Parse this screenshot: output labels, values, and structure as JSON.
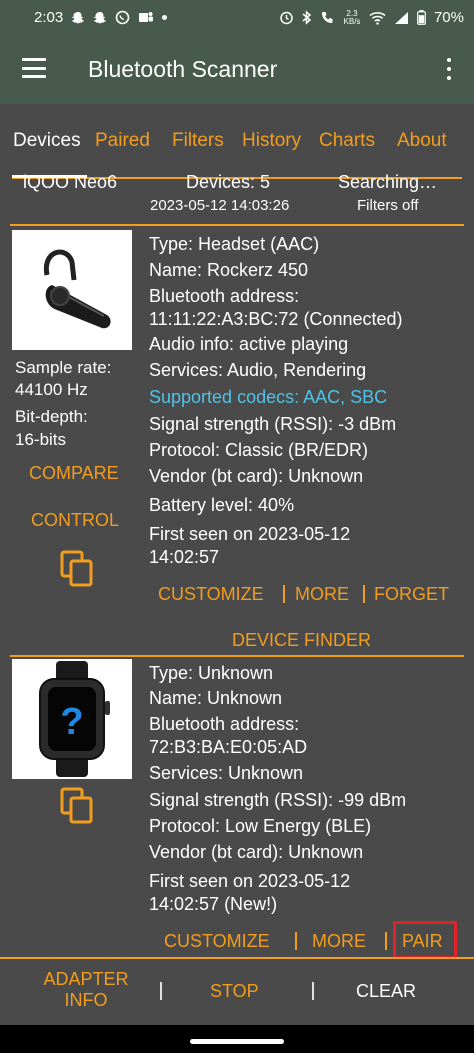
{
  "status_bar": {
    "time": "2:03",
    "battery": "70%",
    "network_speed": "2.3\nKB/s"
  },
  "app_bar": {
    "title": "Bluetooth Scanner"
  },
  "tabs": [
    {
      "label": "Devices"
    },
    {
      "label": "Paired"
    },
    {
      "label": "Filters"
    },
    {
      "label": "History"
    },
    {
      "label": "Charts"
    },
    {
      "label": "About"
    }
  ],
  "info": {
    "device_name": "iQOO Neo6",
    "devices_count": "Devices: 5",
    "status": "Searching…",
    "timestamp": "2023-05-12 14:03:26",
    "filters": "Filters off"
  },
  "devices": [
    {
      "type": "Type: Headset (AAC)",
      "name": "Name: Rockerz 450",
      "address_label": "Bluetooth address:",
      "address": "11:11:22:A3:BC:72 (Connected)",
      "audio_info": "Audio info: active playing",
      "services": "Services: Audio, Rendering",
      "codecs": "Supported codecs: AAC, SBC",
      "signal": "Signal strength (RSSI): -3 dBm",
      "protocol": "Protocol: Classic (BR/EDR)",
      "vendor": "Vendor (bt card): Unknown",
      "battery": "Battery level: 40%",
      "first_seen_label": "First seen on 2023-05-12",
      "first_seen_time": "14:02:57",
      "sample_rate_label": "Sample rate:",
      "sample_rate": "44100 Hz",
      "bit_depth_label": "Bit-depth:",
      "bit_depth": "16-bits",
      "compare_label": "COMPARE",
      "control_label": "CONTROL",
      "customize_label": "CUSTOMIZE",
      "more_label": "MORE",
      "forget_label": "FORGET",
      "finder_label": "DEVICE FINDER",
      "image_icon": "headset-image"
    },
    {
      "type": "Type: Unknown",
      "name": "Name: Unknown",
      "address_label": "Bluetooth address:",
      "address": "72:B3:BA:E0:05:AD",
      "services": "Services: Unknown",
      "signal": "Signal strength (RSSI): -99 dBm",
      "protocol": "Protocol: Low Energy (BLE)",
      "vendor": "Vendor (bt card): Unknown",
      "first_seen_label": "First seen on 2023-05-12",
      "first_seen_time": "14:02:57 (New!)",
      "customize_label": "CUSTOMIZE",
      "more_label": "MORE",
      "pair_label": "PAIR",
      "image_icon": "unknown-watch-image"
    }
  ],
  "bottom_bar": {
    "adapter_info_line1": "ADAPTER",
    "adapter_info_line2": "INFO",
    "stop_label": "STOP",
    "clear_label": "CLEAR"
  },
  "colors": {
    "accent": "#f29d1e",
    "link": "#4fc3e8",
    "appbar": "#475a4d",
    "panel": "#4a4a4a",
    "highlight": "#e0232b"
  }
}
